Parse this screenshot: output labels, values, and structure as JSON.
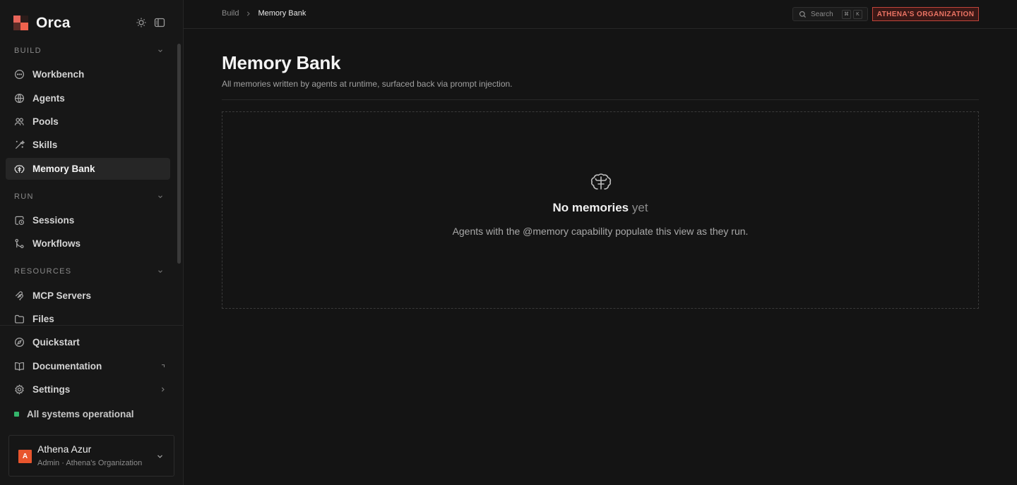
{
  "app": {
    "name": "Orca"
  },
  "sidebar": {
    "sections": [
      {
        "title": "BUILD",
        "items": [
          {
            "label": "Workbench",
            "icon": "chat-bubble-icon"
          },
          {
            "label": "Agents",
            "icon": "globe-icon"
          },
          {
            "label": "Pools",
            "icon": "users-icon"
          },
          {
            "label": "Skills",
            "icon": "wand-icon"
          },
          {
            "label": "Memory Bank",
            "icon": "brain-icon",
            "active": true
          }
        ]
      },
      {
        "title": "RUN",
        "items": [
          {
            "label": "Sessions",
            "icon": "clock-icon"
          },
          {
            "label": "Workflows",
            "icon": "git-branch-icon"
          }
        ]
      },
      {
        "title": "RESOURCES",
        "items": [
          {
            "label": "MCP Servers",
            "icon": "plug-icon"
          },
          {
            "label": "Files",
            "icon": "folder-icon"
          }
        ]
      }
    ],
    "footer_items": [
      {
        "label": "Quickstart",
        "icon": "compass-icon"
      },
      {
        "label": "Documentation",
        "icon": "book-icon",
        "trailing": "external-link-icon"
      },
      {
        "label": "Settings",
        "icon": "gear-icon",
        "trailing": "chevron-right-icon"
      }
    ],
    "status": {
      "label": "All systems operational",
      "color": "#34b56b"
    },
    "user": {
      "initial": "A",
      "name": "Athena Azur",
      "role": "Admin · Athena's Organization",
      "avatar_color": "#e8552d"
    }
  },
  "topbar": {
    "breadcrumb": {
      "parent": "Build",
      "current": "Memory Bank"
    },
    "search": {
      "placeholder": "Search",
      "shortcut": [
        "⌘",
        "K"
      ]
    },
    "org_badge": "ATHENA'S ORGANIZATION"
  },
  "main": {
    "title": "Memory Bank",
    "subtitle": "All memories written by agents at runtime, surfaced back via prompt injection.",
    "empty_state": {
      "title": "No memories",
      "title_muted": "yet",
      "description": "Agents with the @memory capability populate this view as they run."
    }
  },
  "colors": {
    "background": "#141414",
    "sidebar_bg": "#171717",
    "accent": "#e8655a",
    "org_badge": "#c1443a"
  }
}
